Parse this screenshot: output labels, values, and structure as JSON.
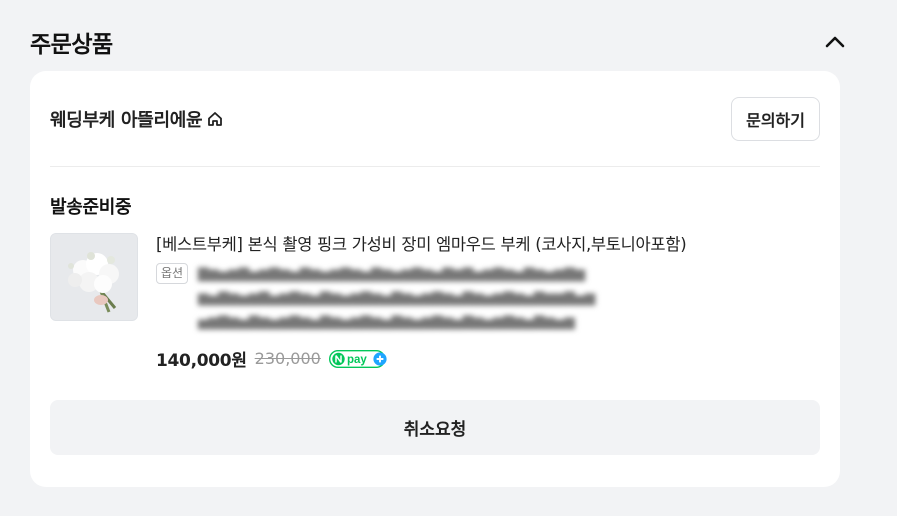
{
  "section": {
    "title": "주문상품",
    "toggle_icon": "chevron-up-icon"
  },
  "shop": {
    "name": "웨딩부케 아뜰리에윤",
    "home_icon": "home-icon",
    "inquiry_label": "문의하기"
  },
  "order": {
    "status": "발송준비중",
    "product": {
      "title": "[베스트부케] 본식 촬영 핑크 가성비 장미 엠마우드 부케 (코사지,부토니아포함)",
      "option_badge": "옵션",
      "price": "140,000원",
      "original_price": "230,000",
      "npay_badge": "pay"
    },
    "cancel_label": "취소요청"
  }
}
